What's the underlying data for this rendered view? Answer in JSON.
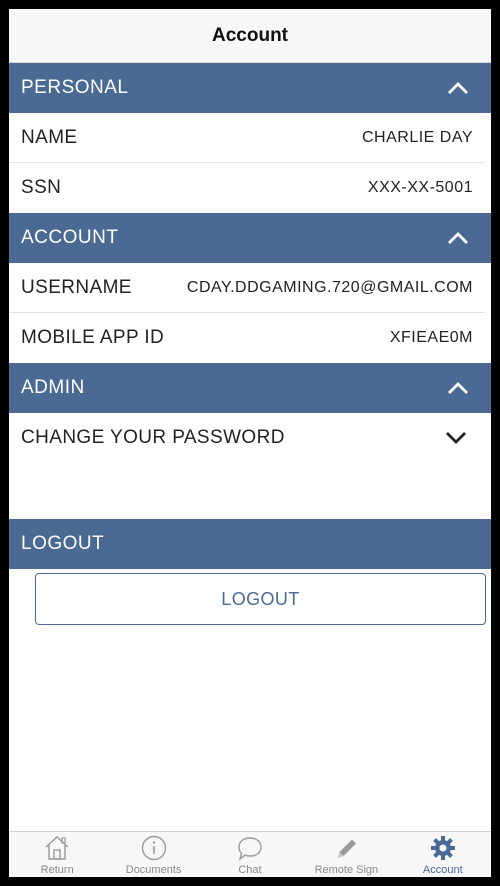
{
  "header": {
    "title": "Account"
  },
  "sections": {
    "personal": {
      "title": "PERSONAL",
      "rows": [
        {
          "label": "NAME",
          "value": "CHARLIE DAY"
        },
        {
          "label": "SSN",
          "value": "XXX-XX-5001"
        }
      ]
    },
    "account": {
      "title": "ACCOUNT",
      "rows": [
        {
          "label": "USERNAME",
          "value": "CDAY.DDGAMING.720@GMAIL.COM"
        },
        {
          "label": "MOBILE APP ID",
          "value": "XFIEAE0M"
        }
      ]
    },
    "admin": {
      "title": "ADMIN",
      "rows": [
        {
          "label": "CHANGE YOUR PASSWORD"
        }
      ]
    },
    "logout": {
      "title": "LOGOUT",
      "button_label": "LOGOUT"
    }
  },
  "tabbar": {
    "items": [
      {
        "label": "Return",
        "icon": "house-icon"
      },
      {
        "label": "Documents",
        "icon": "info-icon"
      },
      {
        "label": "Chat",
        "icon": "chat-bubble-icon"
      },
      {
        "label": "Remote Sign",
        "icon": "pencil-icon"
      },
      {
        "label": "Account",
        "icon": "gear-icon",
        "active": true
      }
    ]
  },
  "colors": {
    "accent": "#4a6a94",
    "background": "#ffffff",
    "tab_inactive": "#8a8a8a"
  }
}
